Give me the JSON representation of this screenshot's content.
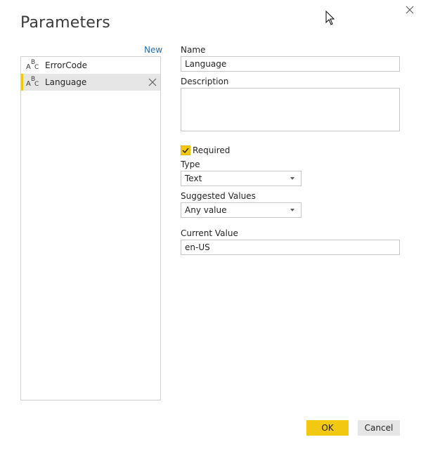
{
  "dialog": {
    "title": "Parameters",
    "new_label": "New"
  },
  "parameters": [
    {
      "type_glyph": "ABC",
      "name": "ErrorCode",
      "selected": false
    },
    {
      "type_glyph": "ABC",
      "name": "Language",
      "selected": true
    }
  ],
  "form": {
    "name_label": "Name",
    "name_value": "Language",
    "description_label": "Description",
    "description_value": "",
    "required_label": "Required",
    "required_checked": true,
    "type_label": "Type",
    "type_value": "Text",
    "suggested_label": "Suggested Values",
    "suggested_value": "Any value",
    "current_label": "Current Value",
    "current_value": "en-US"
  },
  "buttons": {
    "ok": "OK",
    "cancel": "Cancel"
  },
  "colors": {
    "accent": "#f2c811",
    "link": "#1b6fb5"
  }
}
